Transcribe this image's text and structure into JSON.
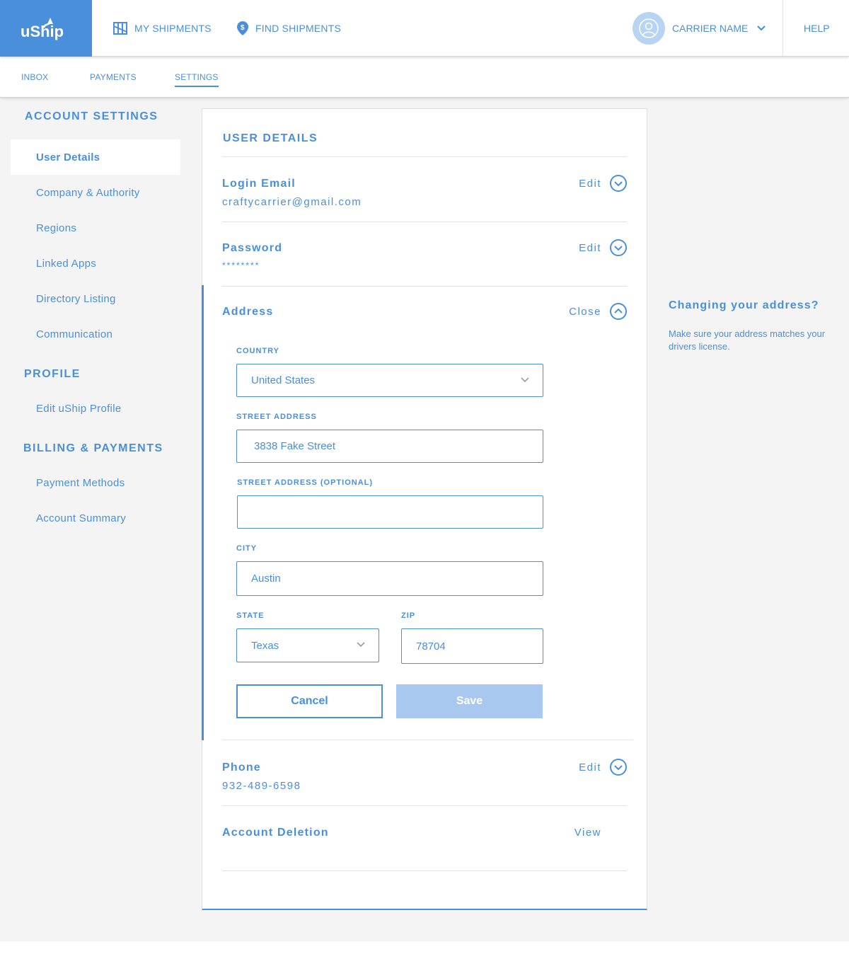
{
  "topbar": {
    "logo": "uShip",
    "nav": [
      {
        "label": "MY SHIPMENTS",
        "icon": "shipments-grid-icon"
      },
      {
        "label": "FIND SHIPMENTS",
        "icon": "location-pin-icon"
      }
    ],
    "carrier_name": "CARRIER NAME",
    "help": "HELP"
  },
  "subnav": {
    "items": [
      "INBOX",
      "PAYMENTS",
      "SETTINGS"
    ],
    "active": "SETTINGS"
  },
  "sidebar": {
    "account_heading": "ACCOUNT SETTINGS",
    "account_items": [
      "User Details",
      "Company & Authority",
      "Regions",
      "Linked Apps",
      "Directory Listing",
      "Communication"
    ],
    "active_item": "User Details",
    "profile_heading": "PROFILE",
    "profile_items": [
      "Edit uShip Profile"
    ],
    "billing_heading": "BILLING & PAYMENTS",
    "billing_items": [
      "Payment Methods",
      "Account Summary"
    ]
  },
  "details": {
    "title": "USER DETAILS",
    "login_email": {
      "label": "Login Email",
      "value": "craftycarrier@gmail.com",
      "action": "Edit"
    },
    "password": {
      "label": "Password",
      "value": "********",
      "action": "Edit"
    },
    "address": {
      "label": "Address",
      "action": "Close",
      "country_label": "COUNTRY",
      "country_value": "United States",
      "street_label": "STREET ADDRESS",
      "street_value": "3838 Fake Street",
      "street2_label": "STREET ADDRESS (OPTIONAL)",
      "street2_value": "",
      "city_label": "CITY",
      "city_value": "Austin",
      "state_label": "STATE",
      "state_value": "Texas",
      "zip_label": "ZIP",
      "zip_value": "78704",
      "cancel": "Cancel",
      "save": "Save"
    },
    "phone": {
      "label": "Phone",
      "value": "932-489-6598",
      "action": "Edit"
    },
    "account_deletion": {
      "label": "Account Deletion",
      "action": "View"
    }
  },
  "hint": {
    "title": "Changing your address?",
    "body": "Make sure your address matches your drivers license."
  },
  "colors": {
    "accent": "#4a8fdc",
    "save_disabled": "#a8c8f0",
    "page_bg": "#f4f4f4"
  }
}
